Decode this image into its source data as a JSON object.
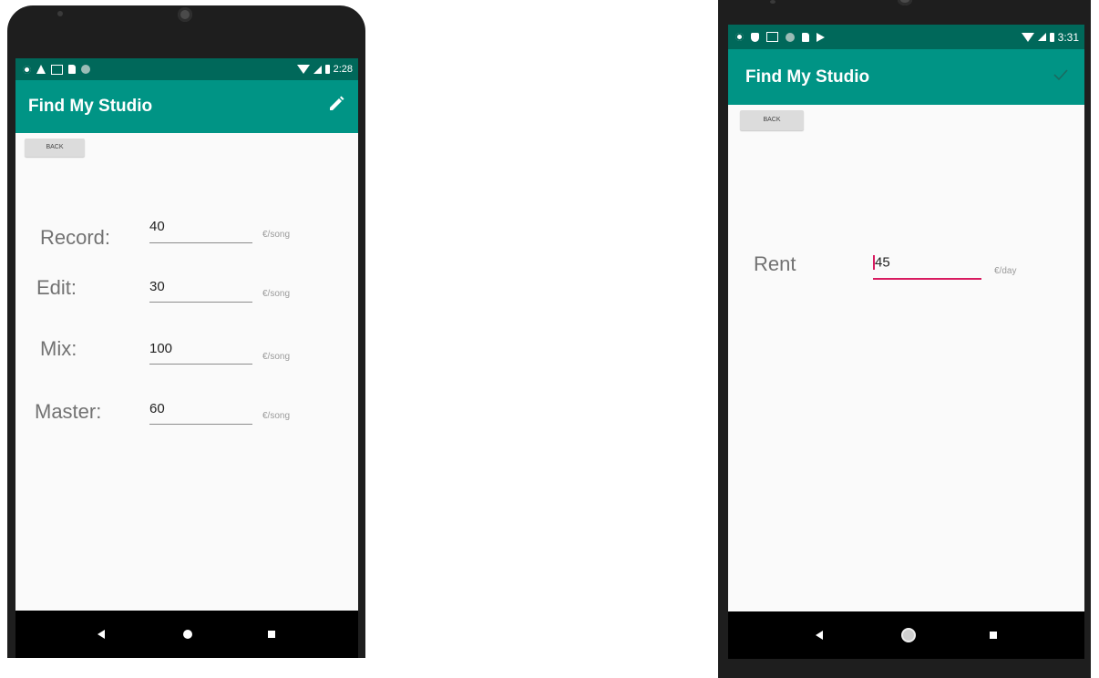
{
  "left_phone": {
    "status": {
      "time": "2:28"
    },
    "app_bar": {
      "title": "Find My Studio",
      "action_icon": "pencil-icon"
    },
    "back_label": "BACK",
    "rows": [
      {
        "label": "Record:",
        "value": "40",
        "unit": "€/song"
      },
      {
        "label": "Edit:",
        "value": "30",
        "unit": "€/song"
      },
      {
        "label": "Mix:",
        "value": "100",
        "unit": "€/song"
      },
      {
        "label": "Master:",
        "value": "60",
        "unit": "€/song"
      }
    ]
  },
  "right_phone": {
    "status": {
      "time": "3:31"
    },
    "app_bar": {
      "title": "Find My Studio",
      "action_icon": "check-icon"
    },
    "back_label": "BACK",
    "rent": {
      "label": "Rent",
      "value": "45",
      "unit": "€/day"
    }
  },
  "colors": {
    "status_bar": "#00685a",
    "app_bar": "#009485",
    "focus_underline": "#d81b60"
  }
}
